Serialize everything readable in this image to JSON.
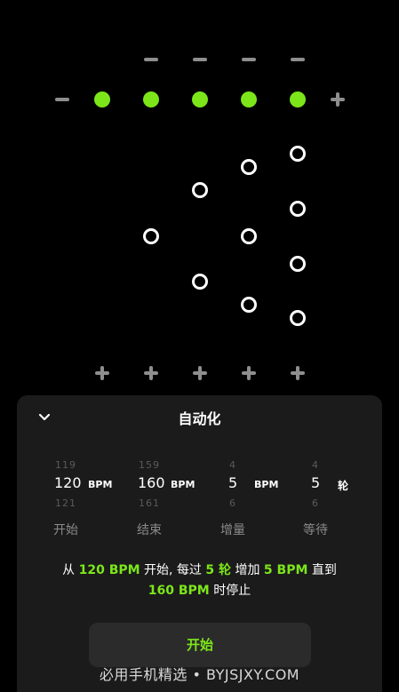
{
  "automation": {
    "title": "自动化",
    "columns": [
      {
        "above": "119",
        "value": "120",
        "below": "121",
        "unit": "BPM",
        "label": "开始"
      },
      {
        "above": "159",
        "value": "160",
        "below": "161",
        "unit": "BPM",
        "label": "结束"
      },
      {
        "above": "4",
        "value": "5",
        "below": "6",
        "unit": "BPM",
        "label": "增量"
      },
      {
        "above": "4",
        "value": "5",
        "below": "6",
        "unit": "轮",
        "label": "等待"
      }
    ],
    "summary": {
      "p1": "从 ",
      "v1": "120 BPM",
      "p2": " 开始, 每过 ",
      "v2": "5 轮",
      "p3": " 增加 ",
      "v3": "5 BPM",
      "p4": " 直到 ",
      "v4": "160 BPM",
      "p5": " 时停止"
    },
    "start_label": "开始"
  },
  "beat_grid": {
    "accent_color": "#7ce61a",
    "active_beats": 5,
    "tempo_row_signs": [
      "−",
      "+"
    ]
  },
  "watermark": "必用手机精选 • BYJSJXY.COM"
}
